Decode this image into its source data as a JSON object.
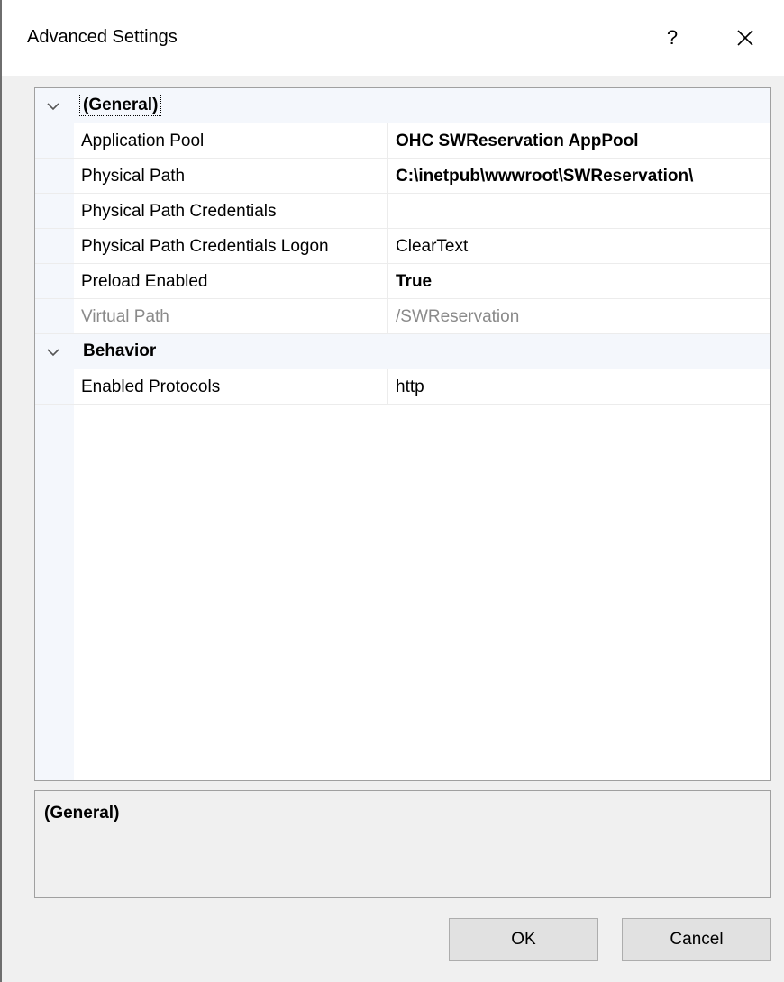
{
  "window": {
    "title": "Advanced Settings",
    "help_label": "?",
    "close_icon": "close-icon"
  },
  "grid": {
    "categories": [
      {
        "label": "(General)",
        "expanded": true,
        "icon": "chevron-down-icon",
        "rows": [
          {
            "name": "Application Pool",
            "value": "OHC SWReservation AppPool",
            "bold": true,
            "disabled": false
          },
          {
            "name": "Physical Path",
            "value": "C:\\inetpub\\wwwroot\\SWReservation\\",
            "bold": true,
            "disabled": false
          },
          {
            "name": "Physical Path Credentials",
            "value": "",
            "bold": false,
            "disabled": false
          },
          {
            "name": "Physical Path Credentials Logon",
            "value": "ClearText",
            "bold": false,
            "disabled": false
          },
          {
            "name": "Preload Enabled",
            "value": "True",
            "bold": true,
            "disabled": false
          },
          {
            "name": "Virtual Path",
            "value": "/SWReservation",
            "bold": false,
            "disabled": true
          }
        ]
      },
      {
        "label": "Behavior",
        "expanded": true,
        "icon": "chevron-down-icon",
        "rows": [
          {
            "name": "Enabled Protocols",
            "value": "http",
            "bold": false,
            "disabled": false
          }
        ]
      }
    ]
  },
  "description": {
    "title": "(General)"
  },
  "buttons": {
    "ok_label": "OK",
    "cancel_label": "Cancel"
  },
  "colors": {
    "gutter": "#f4f7fc",
    "disabled_text": "#8a8a8a",
    "button_face": "#e1e1e1"
  }
}
